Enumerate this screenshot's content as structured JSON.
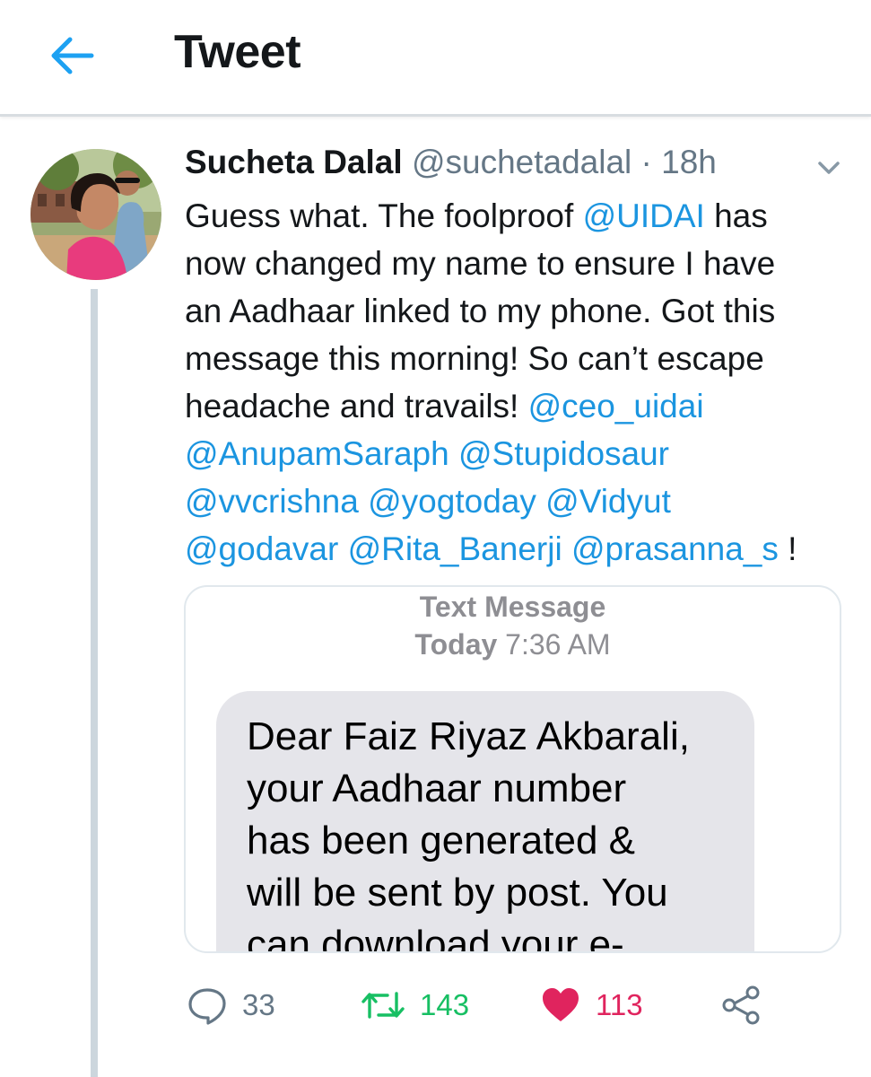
{
  "header": {
    "title": "Tweet",
    "back_icon": "arrow-left-icon"
  },
  "tweet": {
    "author_name": "Sucheta Dalal",
    "author_handle": "@suchetadalal",
    "separator": " · ",
    "time": "18h",
    "text": {
      "l1_a": "Guess what. The foolproof ",
      "l1_m": "@UIDAI",
      "l1_b": " has",
      "l2": "now changed my name to ensure I have",
      "l3": "an Aadhaar linked to my phone. Got this",
      "l4": "message this morning! So can’t escape",
      "l5_a": "headache and travails! ",
      "l5_m": "@ceo_uidai",
      "l6_m1": "@AnupamSaraph",
      "l6_m2": "@Stupidosaur",
      "l7_m1": "@vvcrishna",
      "l7_m2": "@yogtoday",
      "l7_m3": "@Vidyut",
      "l8_m1": "@godavar",
      "l8_m2": "@Rita_Banerji",
      "l8_m3": "@prasanna_s",
      "l8_end": " !"
    },
    "media": {
      "sms_label": "Text Message",
      "sms_day": "Today",
      "sms_time": " 7:36 AM",
      "bubble_lines": [
        "Dear Faiz Riyaz Akbarali,",
        "your Aadhaar number",
        "has been generated &",
        "will be sent by post. You",
        "can download your e-"
      ]
    },
    "actions": {
      "reply_count": "33",
      "retweet_count": "143",
      "like_count": "113"
    }
  },
  "colors": {
    "link": "#1b95e0",
    "retweet": "#17bf63",
    "like": "#e0245e",
    "muted": "#657786"
  }
}
